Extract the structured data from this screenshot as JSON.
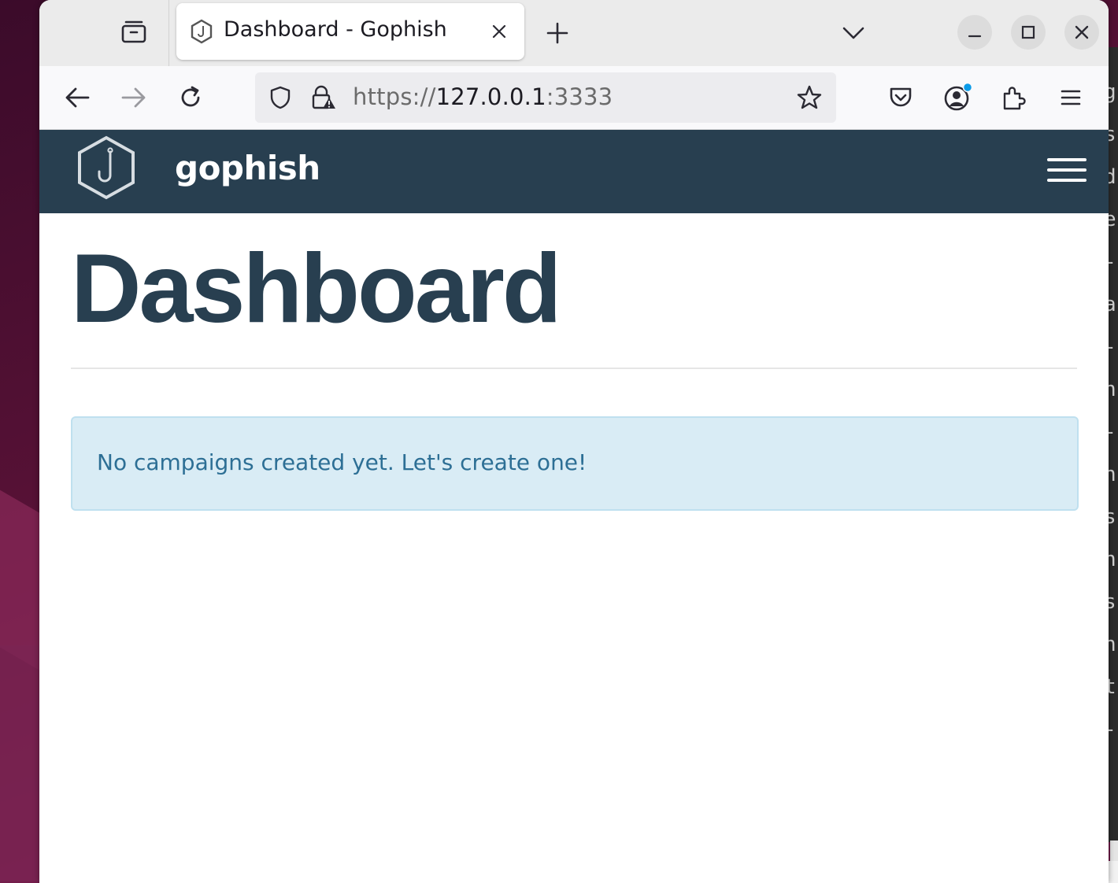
{
  "browser": {
    "tab": {
      "title": "Dashboard - Gophish"
    },
    "url": {
      "scheme": "https://",
      "host": "127.0.0.1",
      "port": ":3333"
    },
    "icons": {
      "tab_list": "firefox-view-icon",
      "tab_close": "close-icon",
      "new_tab": "plus-icon",
      "all_tabs": "chevron-down-icon",
      "minimize": "minimize-icon",
      "maximize": "maximize-icon",
      "close_window": "close-icon",
      "back": "back-arrow-icon",
      "forward": "forward-arrow-icon",
      "reload": "reload-icon",
      "tracking_protection": "shield-icon",
      "insecure_lock": "lock-warning-icon",
      "bookmark": "star-icon",
      "pocket": "pocket-icon",
      "account": "account-icon",
      "extensions": "puzzle-icon",
      "menu": "hamburger-menu-icon"
    },
    "colors": {
      "tabbar_bg": "#ebebeb",
      "toolbar_bg": "#f9f9fb",
      "urlbar_bg": "#ececef",
      "notification_dot": "#0b9be8"
    }
  },
  "app": {
    "brand": "gophish",
    "header_color": "#283f50",
    "icons": {
      "logo": "gophish-hook-logo",
      "menu": "hamburger-menu-icon"
    }
  },
  "page": {
    "title": "Dashboard",
    "alert": {
      "text": "No campaigns created yet. Let's create one!",
      "bg_color": "#d9ecf5",
      "text_color": "#2d6f95"
    }
  },
  "background_window": {
    "glyphs": [
      "g",
      "s",
      "d",
      "e",
      "-",
      "a",
      "-",
      "n",
      "-",
      "n",
      "s",
      "n",
      "s",
      "n",
      "t",
      "-"
    ]
  }
}
